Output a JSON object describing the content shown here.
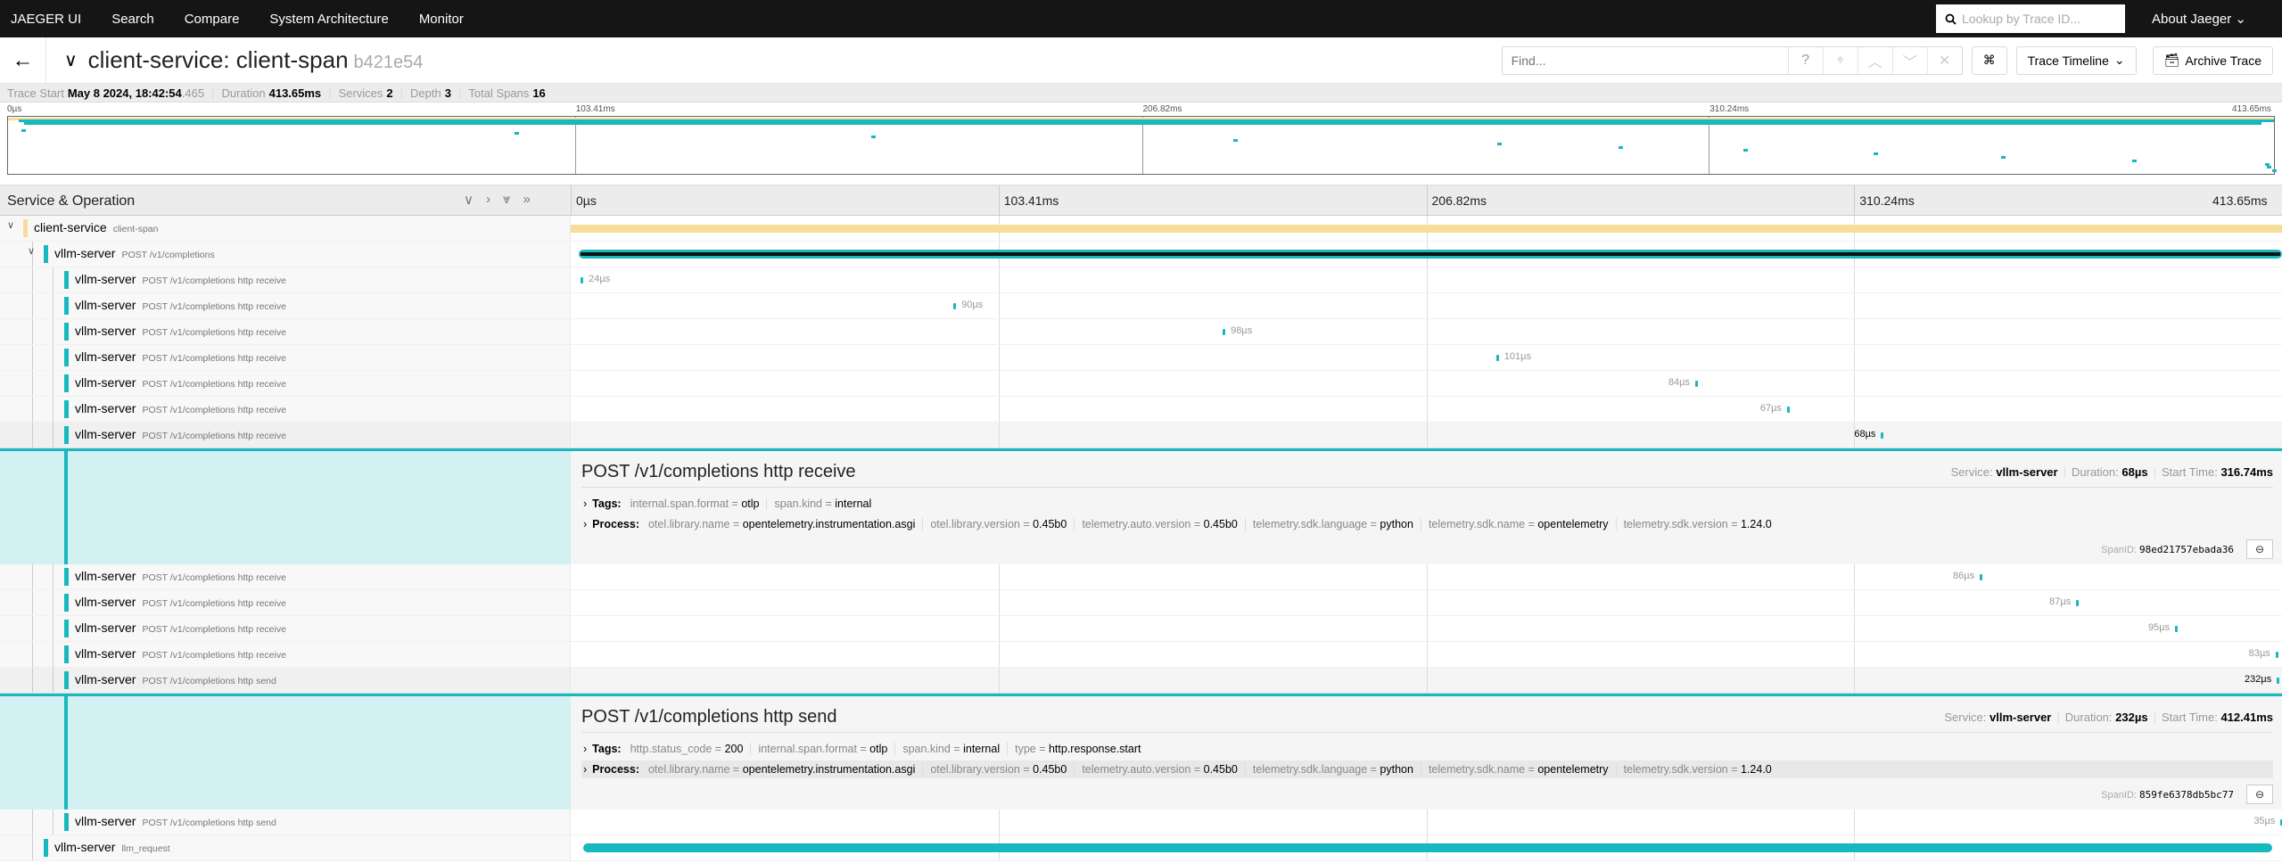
{
  "nav": {
    "brand": "JAEGER UI",
    "items": [
      "Search",
      "Compare",
      "System Architecture",
      "Monitor"
    ],
    "lookup_placeholder": "Lookup by Trace ID...",
    "about": "About Jaeger"
  },
  "header": {
    "title": "client-service: client-span",
    "trace_id": "b421e54",
    "find_placeholder": "Find...",
    "view": "Trace Timeline",
    "archive": "Archive Trace"
  },
  "summary": {
    "trace_start_label": "Trace Start",
    "trace_start": "May 8 2024, 18:42:54",
    "trace_start_ms": ".465",
    "duration_label": "Duration",
    "duration": "413.65ms",
    "services_label": "Services",
    "services": "2",
    "depth_label": "Depth",
    "depth": "3",
    "spans_label": "Total Spans",
    "spans": "16"
  },
  "ticks": [
    "0µs",
    "103.41ms",
    "206.82ms",
    "310.24ms",
    "413.65ms"
  ],
  "total_ms": 413.65,
  "column_header": "Service & Operation",
  "colors": {
    "client": "#f8dc9c",
    "server": "#17b8be"
  },
  "rows": [
    {
      "svc": "client-service",
      "op": "client-span",
      "depth": 0,
      "color": "client",
      "start": 0,
      "dur": 413.65,
      "label": "",
      "toggle": true
    },
    {
      "svc": "vllm-server",
      "op": "POST /v1/completions",
      "depth": 1,
      "color": "server",
      "start": 2,
      "dur": 411.6,
      "label": "",
      "toggle": true,
      "thick": true
    },
    {
      "svc": "vllm-server",
      "op": "POST /v1/completions http receive",
      "depth": 2,
      "color": "server",
      "start": 2.4,
      "dur": 0.024,
      "label": "24µs"
    },
    {
      "svc": "vllm-server",
      "op": "POST /v1/completions http receive",
      "depth": 2,
      "color": "server",
      "start": 92.5,
      "dur": 0.09,
      "label": "90µs"
    },
    {
      "svc": "vllm-server",
      "op": "POST /v1/completions http receive",
      "depth": 2,
      "color": "server",
      "start": 157.6,
      "dur": 0.098,
      "label": "98µs"
    },
    {
      "svc": "vllm-server",
      "op": "POST /v1/completions http receive",
      "depth": 2,
      "color": "server",
      "start": 223.7,
      "dur": 0.101,
      "label": "101µs"
    },
    {
      "svc": "vllm-server",
      "op": "POST /v1/completions http receive",
      "depth": 2,
      "color": "server",
      "start": 271.8,
      "dur": 0.084,
      "label": "84µs"
    },
    {
      "svc": "vllm-server",
      "op": "POST /v1/completions http receive",
      "depth": 2,
      "color": "server",
      "start": 294.0,
      "dur": 0.067,
      "label": "67µs"
    },
    {
      "svc": "vllm-server",
      "op": "POST /v1/completions http receive",
      "depth": 2,
      "color": "server",
      "start": 316.74,
      "dur": 0.068,
      "label": "68µs",
      "selected": true,
      "detail": {
        "title": "POST /v1/completions http receive",
        "service": "vllm-server",
        "duration": "68µs",
        "start_time": "316.74ms",
        "span_id": "98ed21757ebada36",
        "tags": [
          [
            "internal.span.format",
            "otlp"
          ],
          [
            "span.kind",
            "internal"
          ]
        ],
        "process": [
          [
            "otel.library.name",
            "opentelemetry.instrumentation.asgi"
          ],
          [
            "otel.library.version",
            "0.45b0"
          ],
          [
            "telemetry.auto.version",
            "0.45b0"
          ],
          [
            "telemetry.sdk.language",
            "python"
          ],
          [
            "telemetry.sdk.name",
            "opentelemetry"
          ],
          [
            "telemetry.sdk.version",
            "1.24.0"
          ]
        ]
      }
    },
    {
      "svc": "vllm-server",
      "op": "POST /v1/completions http receive",
      "depth": 2,
      "color": "server",
      "start": 340.6,
      "dur": 0.086,
      "label": "86µs"
    },
    {
      "svc": "vllm-server",
      "op": "POST /v1/completions http receive",
      "depth": 2,
      "color": "server",
      "start": 363.9,
      "dur": 0.087,
      "label": "87µs"
    },
    {
      "svc": "vllm-server",
      "op": "POST /v1/completions http receive",
      "depth": 2,
      "color": "server",
      "start": 387.8,
      "dur": 0.095,
      "label": "95µs"
    },
    {
      "svc": "vllm-server",
      "op": "POST /v1/completions http receive",
      "depth": 2,
      "color": "server",
      "start": 412.1,
      "dur": 0.083,
      "label": "83µs"
    },
    {
      "svc": "vllm-server",
      "op": "POST /v1/completions http send",
      "depth": 2,
      "color": "server",
      "start": 412.41,
      "dur": 0.232,
      "label": "232µs",
      "selected": true,
      "detail": {
        "title": "POST /v1/completions http send",
        "service": "vllm-server",
        "duration": "232µs",
        "start_time": "412.41ms",
        "span_id": "859fe6378db5bc77",
        "process_highlight": true,
        "tags": [
          [
            "http.status_code",
            "200"
          ],
          [
            "internal.span.format",
            "otlp"
          ],
          [
            "span.kind",
            "internal"
          ],
          [
            "type",
            "http.response.start"
          ]
        ],
        "process": [
          [
            "otel.library.name",
            "opentelemetry.instrumentation.asgi"
          ],
          [
            "otel.library.version",
            "0.45b0"
          ],
          [
            "telemetry.auto.version",
            "0.45b0"
          ],
          [
            "telemetry.sdk.language",
            "python"
          ],
          [
            "telemetry.sdk.name",
            "opentelemetry"
          ],
          [
            "telemetry.sdk.version",
            "1.24.0"
          ]
        ]
      }
    },
    {
      "svc": "vllm-server",
      "op": "POST /v1/completions http send",
      "depth": 2,
      "color": "server",
      "start": 413.3,
      "dur": 0.035,
      "label": "35µs"
    },
    {
      "svc": "vllm-server",
      "op": "llm_request",
      "depth": 1,
      "color": "server",
      "start": 3,
      "dur": 408.3,
      "label": "",
      "thick": true
    }
  ],
  "detail_labels": {
    "service": "Service:",
    "duration": "Duration:",
    "start": "Start Time:",
    "tags": "Tags:",
    "process": "Process:",
    "span_id": "SpanID:"
  }
}
